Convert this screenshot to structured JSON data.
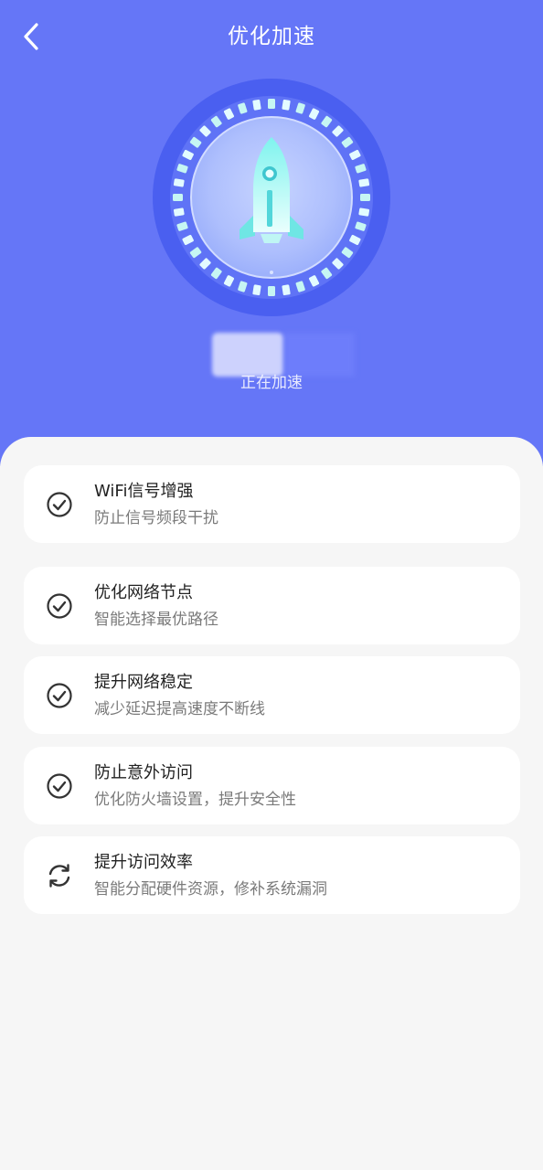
{
  "header": {
    "title": "优化加速",
    "back_icon": "chevron-left-icon",
    "background": "#6576f7"
  },
  "accelerator": {
    "icon": "rocket-icon",
    "status": "正在加速",
    "speed_value": ""
  },
  "tasks": [
    {
      "title": "WiFi信号增强",
      "subtitle": "防止信号频段干扰",
      "state": "done",
      "icon": "check-circle-icon"
    },
    {
      "title": "优化网络节点",
      "subtitle": "智能选择最优路径",
      "state": "done",
      "icon": "check-circle-icon"
    },
    {
      "title": "提升网络稳定",
      "subtitle": "减少延迟提高速度不断线",
      "state": "done",
      "icon": "check-circle-icon"
    },
    {
      "title": "防止意外访问",
      "subtitle": "优化防火墙设置，提升安全性",
      "state": "done",
      "icon": "check-circle-icon"
    },
    {
      "title": "提升访问效率",
      "subtitle": "智能分配硬件资源，修补系统漏洞",
      "state": "in-progress",
      "icon": "refresh-icon"
    }
  ]
}
